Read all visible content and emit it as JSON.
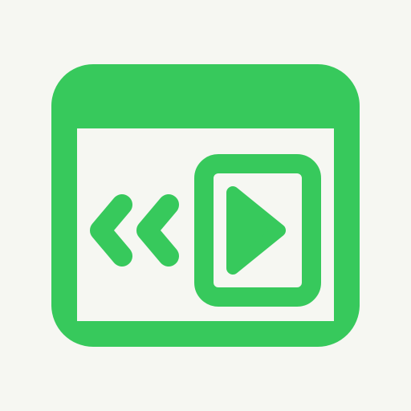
{
  "icon": {
    "name": "browser-window-rewind-video-icon",
    "parts": {
      "window": "browser-window-icon",
      "rewind": "double-chevron-left-icon",
      "media": "video-play-icon"
    },
    "colors": {
      "background": "#F6F7F2",
      "accent": "#37C95C",
      "inner": "#F6F7F2"
    }
  }
}
